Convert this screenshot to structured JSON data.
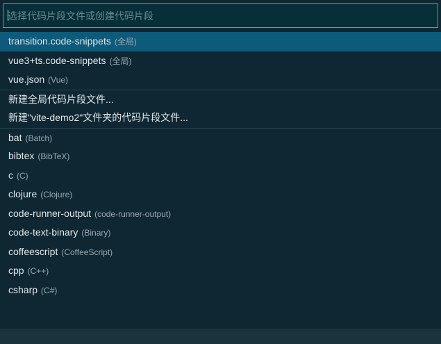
{
  "quick_pick": {
    "placeholder": "选择代码片段文件或创建代码片段",
    "groups": [
      [
        {
          "label": "transition.code-snippets",
          "desc": "(全局)",
          "selected": true
        },
        {
          "label": "vue3+ts.code-snippets",
          "desc": "(全局)"
        },
        {
          "label": "vue.json",
          "desc": "(Vue)"
        }
      ],
      [
        {
          "label": "新建全局代码片段文件...",
          "desc": ""
        },
        {
          "label": "新建\"vite-demo2\"文件夹的代码片段文件...",
          "desc": ""
        }
      ],
      [
        {
          "label": "bat",
          "desc": "(Batch)"
        },
        {
          "label": "bibtex",
          "desc": "(BibTeX)"
        },
        {
          "label": "c",
          "desc": "(C)"
        },
        {
          "label": "clojure",
          "desc": "(Clojure)"
        },
        {
          "label": "code-runner-output",
          "desc": "(code-runner-output)"
        },
        {
          "label": "code-text-binary",
          "desc": "(Binary)"
        },
        {
          "label": "coffeescript",
          "desc": "(CoffeeScript)"
        },
        {
          "label": "cpp",
          "desc": "(C++)"
        },
        {
          "label": "csharp",
          "desc": "(C#)"
        }
      ]
    ]
  },
  "colors": {
    "background": "#0e2733",
    "selected": "#0d5a7a",
    "input_border": "#3fb4a6"
  }
}
